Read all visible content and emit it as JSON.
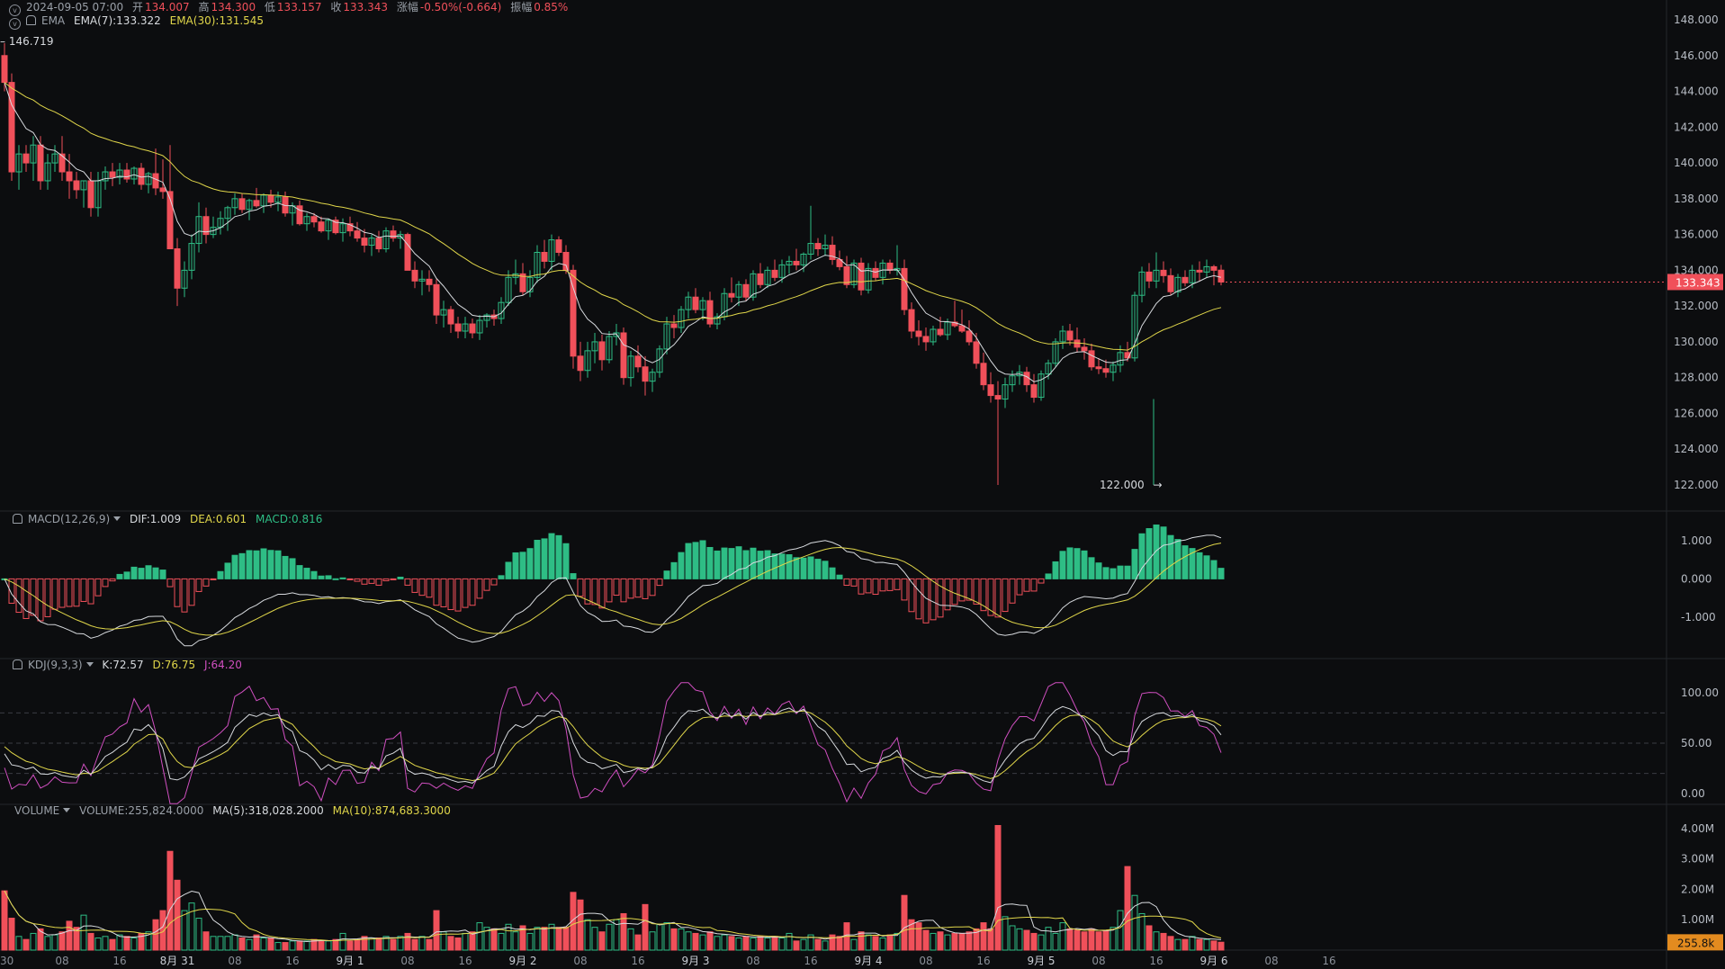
{
  "header": {
    "datetime": "2024-09-05 07:00",
    "open_label": "开",
    "open": "134.007",
    "high_label": "高",
    "high": "134.300",
    "low_label": "低",
    "low": "133.157",
    "close_label": "收",
    "close": "133.343",
    "change_label": "涨幅",
    "change": "-0.50%(-0.664)",
    "amp_label": "振幅",
    "amp": "0.85%",
    "ema_label": "EMA",
    "ema7": "EMA(7):133.322",
    "ema30": "EMA(30):131.545",
    "hi_marker": "146.719",
    "lo_marker": "122.000"
  },
  "macd_header": {
    "name": "MACD(12,26,9)",
    "dif": "DIF:1.009",
    "dea": "DEA:0.601",
    "macd": "MACD:0.816"
  },
  "kdj_header": {
    "name": "KDJ(9,3,3)",
    "k": "K:72.57",
    "d": "D:76.75",
    "j": "J:64.20"
  },
  "vol_header": {
    "name": "VOLUME",
    "vol": "VOLUME:255,824.0000",
    "ma5": "MA(5):318,028.2000",
    "ma10": "MA(10):874,683.3000"
  },
  "colors": {
    "up": "#2ebd85",
    "down": "#f0505a",
    "ema7": "#d7dade",
    "ema30": "#e0d64a",
    "kdj_j": "#d04fc0",
    "bg": "#0c0d0f"
  },
  "chart_data": {
    "type": "candlestick",
    "interval": "1h",
    "price_axis": {
      "ticks": [
        "148.000",
        "146.000",
        "144.000",
        "142.000",
        "140.000",
        "138.000",
        "136.000",
        "134.000",
        "132.000",
        "130.000",
        "128.000",
        "126.000",
        "124.000",
        "122.000"
      ],
      "range": [
        121.0,
        148.5
      ]
    },
    "last_price_label": "133.343",
    "time_axis": [
      "30",
      "08",
      "16",
      "8月 31",
      "08",
      "16",
      "9月 1",
      "08",
      "16",
      "9月 2",
      "08",
      "16",
      "9月 3",
      "08",
      "16",
      "9月 4",
      "08",
      "16",
      "9月 5",
      "08",
      "16",
      "9月 6",
      "08",
      "16"
    ],
    "candles": [
      [
        146.0,
        146.7,
        144.0,
        144.5
      ],
      [
        144.5,
        145.0,
        139.0,
        139.5
      ],
      [
        139.5,
        141.0,
        138.5,
        140.5
      ],
      [
        140.5,
        141.0,
        139.5,
        140.0
      ],
      [
        140.0,
        141.5,
        139.0,
        141.0
      ],
      [
        141.0,
        141.5,
        138.5,
        139.0
      ],
      [
        139.0,
        140.5,
        138.5,
        140.0
      ],
      [
        140.0,
        141.0,
        139.5,
        140.5
      ],
      [
        140.5,
        141.5,
        139.0,
        139.5
      ],
      [
        139.5,
        140.5,
        138.0,
        139.0
      ],
      [
        139.0,
        139.5,
        138.0,
        138.5
      ],
      [
        138.5,
        139.0,
        137.5,
        139.0
      ],
      [
        139.0,
        139.5,
        137.0,
        137.5
      ],
      [
        137.5,
        139.5,
        137.0,
        139.0
      ],
      [
        139.0,
        139.8,
        138.5,
        139.5
      ],
      [
        139.5,
        140.0,
        138.7,
        139.2
      ],
      [
        139.2,
        140.0,
        138.8,
        139.6
      ],
      [
        139.6,
        140.0,
        138.9,
        139.1
      ],
      [
        139.1,
        139.8,
        138.8,
        139.7
      ],
      [
        139.7,
        140.0,
        138.5,
        138.8
      ],
      [
        138.8,
        139.5,
        138.3,
        139.4
      ],
      [
        139.4,
        140.8,
        138.2,
        138.6
      ],
      [
        138.6,
        140.2,
        138.0,
        138.4
      ],
      [
        138.4,
        141.0,
        137.0,
        135.2
      ],
      [
        135.2,
        135.8,
        132.0,
        133.0
      ],
      [
        133.0,
        134.5,
        132.5,
        134.0
      ],
      [
        134.0,
        136.0,
        133.5,
        135.5
      ],
      [
        135.5,
        137.8,
        135.0,
        137.0
      ],
      [
        137.0,
        137.5,
        135.5,
        136.0
      ],
      [
        136.0,
        137.0,
        135.8,
        136.4
      ],
      [
        136.4,
        137.3,
        136.0,
        136.9
      ],
      [
        136.9,
        137.6,
        136.2,
        137.5
      ],
      [
        137.5,
        138.3,
        137.1,
        138.0
      ],
      [
        138.0,
        138.3,
        137.2,
        137.4
      ],
      [
        137.4,
        138.0,
        136.8,
        137.9
      ],
      [
        137.9,
        138.6,
        137.5,
        137.6
      ],
      [
        137.6,
        138.3,
        137.2,
        138.2
      ],
      [
        138.2,
        138.5,
        137.5,
        137.8
      ],
      [
        137.8,
        138.4,
        137.3,
        138.1
      ],
      [
        138.1,
        138.4,
        137.0,
        137.2
      ],
      [
        137.2,
        137.8,
        136.5,
        137.6
      ],
      [
        137.6,
        137.9,
        136.5,
        136.6
      ],
      [
        136.6,
        137.2,
        136.2,
        137.0
      ],
      [
        137.0,
        137.2,
        136.4,
        136.7
      ],
      [
        136.7,
        137.0,
        136.1,
        136.2
      ],
      [
        136.2,
        136.9,
        135.7,
        136.8
      ],
      [
        136.8,
        137.0,
        136.0,
        136.1
      ],
      [
        136.1,
        136.9,
        135.6,
        136.6
      ],
      [
        136.6,
        137.0,
        135.9,
        136.2
      ],
      [
        136.2,
        136.7,
        135.6,
        135.8
      ],
      [
        135.8,
        136.3,
        135.0,
        135.4
      ],
      [
        135.4,
        136.0,
        134.8,
        135.8
      ],
      [
        135.8,
        136.2,
        135.0,
        135.2
      ],
      [
        135.2,
        136.4,
        135.0,
        136.2
      ],
      [
        136.2,
        136.5,
        135.6,
        135.8
      ],
      [
        135.8,
        136.2,
        135.2,
        136.0
      ],
      [
        136.0,
        136.1,
        134.5,
        134.0
      ],
      [
        134.0,
        134.5,
        133.0,
        133.4
      ],
      [
        133.4,
        134.0,
        132.6,
        133.5
      ],
      [
        133.5,
        134.0,
        132.8,
        133.2
      ],
      [
        133.2,
        133.5,
        131.0,
        131.5
      ],
      [
        131.5,
        132.3,
        130.8,
        131.8
      ],
      [
        131.8,
        132.0,
        130.5,
        131.0
      ],
      [
        131.0,
        131.4,
        130.2,
        130.6
      ],
      [
        130.6,
        131.4,
        130.2,
        131.0
      ],
      [
        131.0,
        131.3,
        130.2,
        130.5
      ],
      [
        130.5,
        131.5,
        130.1,
        131.2
      ],
      [
        131.2,
        131.6,
        130.8,
        131.5
      ],
      [
        131.5,
        131.8,
        130.9,
        131.3
      ],
      [
        131.3,
        132.5,
        131.0,
        132.2
      ],
      [
        132.2,
        134.0,
        132.0,
        133.6
      ],
      [
        133.6,
        134.6,
        133.2,
        133.8
      ],
      [
        133.8,
        134.4,
        132.6,
        132.8
      ],
      [
        132.8,
        134.0,
        132.5,
        133.6
      ],
      [
        133.6,
        135.4,
        133.3,
        135.0
      ],
      [
        135.0,
        135.7,
        134.1,
        134.5
      ],
      [
        134.5,
        136.0,
        134.0,
        135.7
      ],
      [
        135.7,
        135.9,
        134.8,
        135.0
      ],
      [
        135.0,
        135.4,
        133.8,
        134.0
      ],
      [
        134.0,
        134.3,
        128.5,
        129.2
      ],
      [
        129.2,
        130.0,
        127.8,
        128.4
      ],
      [
        128.4,
        130.0,
        128.0,
        129.5
      ],
      [
        129.5,
        130.5,
        128.8,
        130.0
      ],
      [
        130.0,
        130.4,
        128.4,
        129.0
      ],
      [
        129.0,
        130.6,
        128.8,
        130.3
      ],
      [
        130.3,
        131.0,
        129.8,
        130.5
      ],
      [
        130.5,
        130.8,
        127.6,
        128.0
      ],
      [
        128.0,
        129.5,
        127.5,
        129.2
      ],
      [
        129.2,
        129.8,
        128.3,
        128.6
      ],
      [
        128.6,
        129.2,
        127.0,
        127.8
      ],
      [
        127.8,
        128.5,
        127.2,
        128.3
      ],
      [
        128.3,
        129.8,
        128.0,
        129.6
      ],
      [
        129.6,
        131.4,
        129.3,
        131.0
      ],
      [
        131.0,
        131.5,
        130.2,
        130.8
      ],
      [
        130.8,
        132.0,
        130.5,
        131.8
      ],
      [
        131.8,
        132.8,
        131.3,
        132.5
      ],
      [
        132.5,
        133.0,
        131.6,
        131.8
      ],
      [
        131.8,
        132.5,
        131.2,
        132.3
      ],
      [
        132.3,
        132.8,
        130.8,
        131.0
      ],
      [
        131.0,
        131.6,
        130.7,
        131.4
      ],
      [
        131.4,
        133.0,
        131.2,
        132.7
      ],
      [
        132.7,
        133.6,
        132.2,
        132.5
      ],
      [
        132.5,
        133.4,
        132.0,
        133.2
      ],
      [
        133.2,
        133.5,
        132.3,
        132.5
      ],
      [
        132.5,
        134.0,
        132.3,
        133.8
      ],
      [
        133.8,
        134.4,
        133.0,
        133.2
      ],
      [
        133.2,
        134.2,
        133.0,
        134.0
      ],
      [
        134.0,
        134.6,
        133.4,
        133.6
      ],
      [
        133.6,
        134.6,
        133.3,
        134.3
      ],
      [
        134.3,
        134.8,
        133.8,
        134.5
      ],
      [
        134.5,
        135.2,
        134.0,
        134.3
      ],
      [
        134.3,
        135.0,
        133.9,
        134.9
      ],
      [
        134.9,
        137.6,
        134.6,
        135.5
      ],
      [
        135.5,
        135.8,
        134.8,
        135.2
      ],
      [
        135.2,
        136.0,
        134.8,
        135.4
      ],
      [
        135.4,
        135.9,
        134.3,
        134.6
      ],
      [
        134.6,
        135.1,
        134.0,
        134.2
      ],
      [
        134.2,
        134.8,
        133.0,
        133.2
      ],
      [
        133.2,
        134.6,
        133.0,
        134.4
      ],
      [
        134.4,
        134.7,
        132.6,
        132.9
      ],
      [
        132.9,
        134.4,
        132.7,
        134.1
      ],
      [
        134.1,
        134.5,
        133.4,
        133.6
      ],
      [
        133.6,
        134.6,
        133.2,
        134.4
      ],
      [
        134.4,
        134.6,
        133.8,
        134.0
      ],
      [
        134.0,
        135.4,
        133.7,
        134.1
      ],
      [
        134.1,
        134.6,
        131.5,
        131.8
      ],
      [
        131.8,
        132.2,
        130.2,
        130.6
      ],
      [
        130.6,
        131.2,
        129.8,
        130.3
      ],
      [
        130.3,
        130.8,
        129.5,
        130.0
      ],
      [
        130.0,
        130.9,
        129.8,
        130.7
      ],
      [
        130.7,
        131.4,
        130.3,
        130.4
      ],
      [
        130.4,
        131.3,
        130.1,
        131.1
      ],
      [
        131.1,
        132.3,
        130.8,
        130.9
      ],
      [
        130.9,
        131.8,
        130.5,
        130.6
      ],
      [
        130.6,
        131.2,
        129.8,
        130.0
      ],
      [
        130.0,
        130.5,
        128.5,
        128.8
      ],
      [
        128.8,
        129.4,
        127.3,
        127.6
      ],
      [
        127.6,
        128.3,
        126.6,
        127.0
      ],
      [
        127.0,
        127.8,
        122.0,
        126.8
      ],
      [
        126.8,
        128.0,
        126.3,
        127.6
      ],
      [
        127.6,
        128.4,
        127.2,
        128.1
      ],
      [
        128.1,
        128.7,
        127.6,
        128.3
      ],
      [
        128.3,
        128.6,
        127.2,
        127.6
      ],
      [
        127.6,
        128.2,
        126.6,
        126.9
      ],
      [
        126.9,
        128.4,
        126.7,
        128.2
      ],
      [
        128.2,
        129.0,
        127.9,
        128.8
      ],
      [
        128.8,
        130.2,
        128.6,
        130.0
      ],
      [
        130.0,
        130.9,
        129.6,
        130.6
      ],
      [
        130.6,
        131.0,
        129.8,
        130.1
      ],
      [
        130.1,
        130.8,
        129.4,
        129.7
      ],
      [
        129.7,
        130.2,
        129.0,
        129.5
      ],
      [
        129.5,
        129.9,
        128.4,
        128.6
      ],
      [
        128.6,
        129.1,
        128.2,
        128.5
      ],
      [
        128.5,
        129.0,
        128.0,
        128.3
      ],
      [
        128.3,
        128.9,
        127.8,
        128.7
      ],
      [
        128.7,
        129.8,
        128.3,
        129.4
      ],
      [
        129.4,
        130.0,
        128.9,
        129.1
      ],
      [
        129.1,
        132.8,
        128.9,
        132.6
      ],
      [
        132.6,
        134.2,
        132.2,
        133.9
      ],
      [
        133.9,
        134.4,
        133.0,
        133.4
      ],
      [
        133.4,
        135.0,
        133.0,
        134.0
      ],
      [
        134.0,
        134.5,
        133.3,
        133.7
      ],
      [
        133.7,
        134.1,
        132.6,
        132.8
      ],
      [
        132.8,
        133.8,
        132.5,
        133.6
      ],
      [
        133.6,
        134.0,
        133.1,
        133.3
      ],
      [
        133.3,
        134.3,
        133.0,
        134.0
      ],
      [
        134.0,
        134.5,
        133.4,
        133.9
      ],
      [
        133.9,
        134.6,
        133.6,
        134.2
      ],
      [
        134.2,
        134.3,
        133.16,
        134.0
      ],
      [
        134.007,
        134.3,
        133.157,
        133.343
      ]
    ],
    "volumes": [
      1.95,
      1.05,
      0.45,
      0.35,
      0.55,
      0.7,
      0.45,
      0.5,
      0.6,
      0.95,
      0.75,
      1.15,
      0.55,
      0.4,
      0.45,
      0.35,
      0.5,
      0.45,
      0.4,
      0.55,
      0.6,
      1.0,
      1.3,
      3.25,
      2.3,
      1.3,
      1.55,
      1.05,
      0.6,
      0.45,
      0.45,
      0.45,
      0.5,
      0.4,
      0.35,
      0.5,
      0.4,
      0.4,
      0.25,
      0.25,
      0.3,
      0.3,
      0.3,
      0.35,
      0.3,
      0.3,
      0.35,
      0.55,
      0.3,
      0.35,
      0.45,
      0.4,
      0.4,
      0.45,
      0.35,
      0.45,
      0.55,
      0.35,
      0.45,
      0.35,
      1.3,
      0.6,
      0.45,
      0.4,
      0.55,
      0.6,
      0.9,
      0.75,
      0.7,
      0.55,
      0.85,
      0.6,
      0.8,
      0.55,
      0.75,
      0.75,
      0.85,
      0.75,
      0.75,
      1.9,
      1.65,
      1.0,
      0.75,
      0.6,
      0.85,
      1.0,
      1.2,
      0.7,
      0.5,
      1.5,
      0.6,
      0.85,
      0.9,
      0.7,
      0.7,
      0.6,
      0.55,
      0.5,
      0.6,
      0.45,
      0.5,
      0.45,
      0.4,
      0.45,
      0.4,
      0.45,
      0.4,
      0.45,
      0.4,
      0.55,
      0.3,
      0.35,
      0.5,
      0.35,
      0.3,
      0.5,
      0.45,
      0.9,
      0.35,
      0.6,
      0.5,
      0.45,
      0.4,
      0.5,
      0.55,
      1.8,
      1.0,
      0.9,
      0.65,
      0.55,
      0.6,
      0.5,
      0.55,
      0.55,
      0.6,
      0.7,
      0.9,
      0.7,
      4.1,
      1.1,
      0.8,
      0.7,
      0.65,
      0.55,
      0.5,
      0.75,
      0.55,
      0.9,
      0.7,
      0.65,
      0.6,
      0.7,
      0.6,
      0.65,
      0.75,
      1.3,
      2.75,
      1.8,
      1.2,
      0.8,
      0.6,
      0.55,
      0.45,
      0.35,
      0.35,
      0.45,
      0.35,
      0.35,
      0.3,
      0.26
    ],
    "volume_axis": {
      "ticks": [
        "4.00M",
        "3.00M",
        "2.00M",
        "1.00M"
      ],
      "max": 4.5,
      "last_label": "255.8k"
    },
    "macd_axis": {
      "ticks": [
        "1.000",
        "0.000",
        "-1.000"
      ],
      "range": [
        -1.9,
        1.4
      ]
    },
    "kdj_axis": {
      "ticks": [
        "100.00",
        "50.00",
        "0.00"
      ],
      "range": [
        -10,
        110
      ],
      "ref_lines": [
        80,
        50,
        20
      ]
    }
  }
}
